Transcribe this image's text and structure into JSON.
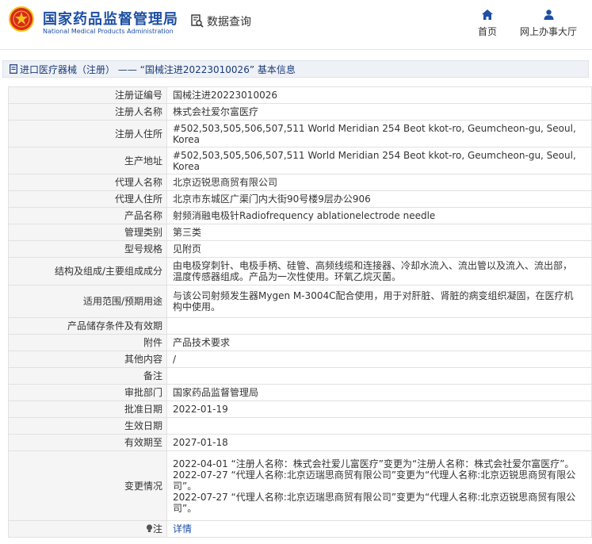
{
  "header": {
    "site_title_cn": "国家药品监督管理局",
    "site_title_en": "National Medical Products Administration",
    "data_query_label": "数据查询",
    "nav": {
      "home_label": "首页",
      "online_service_label": "网上办事大厅"
    }
  },
  "breadcrumb": {
    "text": "进口医疗器械（注册） —— “国械注进20223010026” 基本信息"
  },
  "rows": [
    {
      "label": "注册证编号",
      "value": "国械注进20223010026"
    },
    {
      "label": "注册人名称",
      "value": "株式会社爱尔富医疗"
    },
    {
      "label": "注册人住所",
      "value": "#502,503,505,506,507,511 World Meridian 254 Beot kkot-ro, Geumcheon-gu, Seoul, Korea"
    },
    {
      "label": "生产地址",
      "value": "#502,503,505,506,507,511 World Meridian 254 Beot kkot-ro, Geumcheon-gu, Seoul, Korea"
    },
    {
      "label": "代理人名称",
      "value": "北京迈锐思商贸有限公司"
    },
    {
      "label": "代理人住所",
      "value": "北京市东城区广渠门内大街90号楼9层办公906"
    },
    {
      "label": "产品名称",
      "value": "射频消融电极针Radiofrequency ablationelectrode needle"
    },
    {
      "label": "管理类别",
      "value": "第三类"
    },
    {
      "label": "型号规格",
      "value": "见附页"
    },
    {
      "label": "结构及组成/主要组成成分",
      "value": "由电极穿刺针、电极手柄、硅管、高频线缆和连接器、冷却水流入、流出管以及流入、流出部，温度传感器组成。产品为一次性使用。环氧乙烷灭菌。"
    },
    {
      "label": "适用范围/预期用途",
      "value": "与该公司射频发生器Mygen M-3004C配合使用，用于对肝脏、肾脏的病变组织凝固，在医疗机构中使用。"
    },
    {
      "label": "产品储存条件及有效期",
      "value": ""
    },
    {
      "label": "附件",
      "value": "产品技术要求"
    },
    {
      "label": "其他内容",
      "value": "/"
    },
    {
      "label": "备注",
      "value": ""
    },
    {
      "label": "审批部门",
      "value": "国家药品监督管理局"
    },
    {
      "label": "批准日期",
      "value": "2022-01-19"
    },
    {
      "label": "生效日期",
      "value": ""
    },
    {
      "label": "有效期至",
      "value": "2027-01-18"
    }
  ],
  "changes": {
    "label": "变更情况",
    "entries": [
      "2022-04-01 “注册人名称：株式会社爱儿富医疗”变更为“注册人名称：株式会社爱尔富医疗”。",
      "2022-07-27 “代理人名称:北京迈瑞思商贸有限公司”变更为“代理人名称:北京迈锐思商贸有限公司”。",
      "2022-07-27 “代理人名称:北京迈瑞思商贸有限公司”变更为“代理人名称:北京迈锐思商贸有限公司”。"
    ]
  },
  "note_row": {
    "label": "注",
    "link_text": "详情"
  },
  "colors": {
    "brand_blue": "#1d4fa3",
    "logo_red": "#d8291f",
    "logo_gold": "#f4c21a",
    "label_bg": "#f5f5f5",
    "border": "#e1e1e1"
  },
  "icons": {
    "logo": "nmpa-emblem",
    "data_query": "search-document-icon",
    "home": "home-icon",
    "online_service": "user-icon",
    "breadcrumb": "document-icon",
    "note": "lightbulb-icon"
  }
}
